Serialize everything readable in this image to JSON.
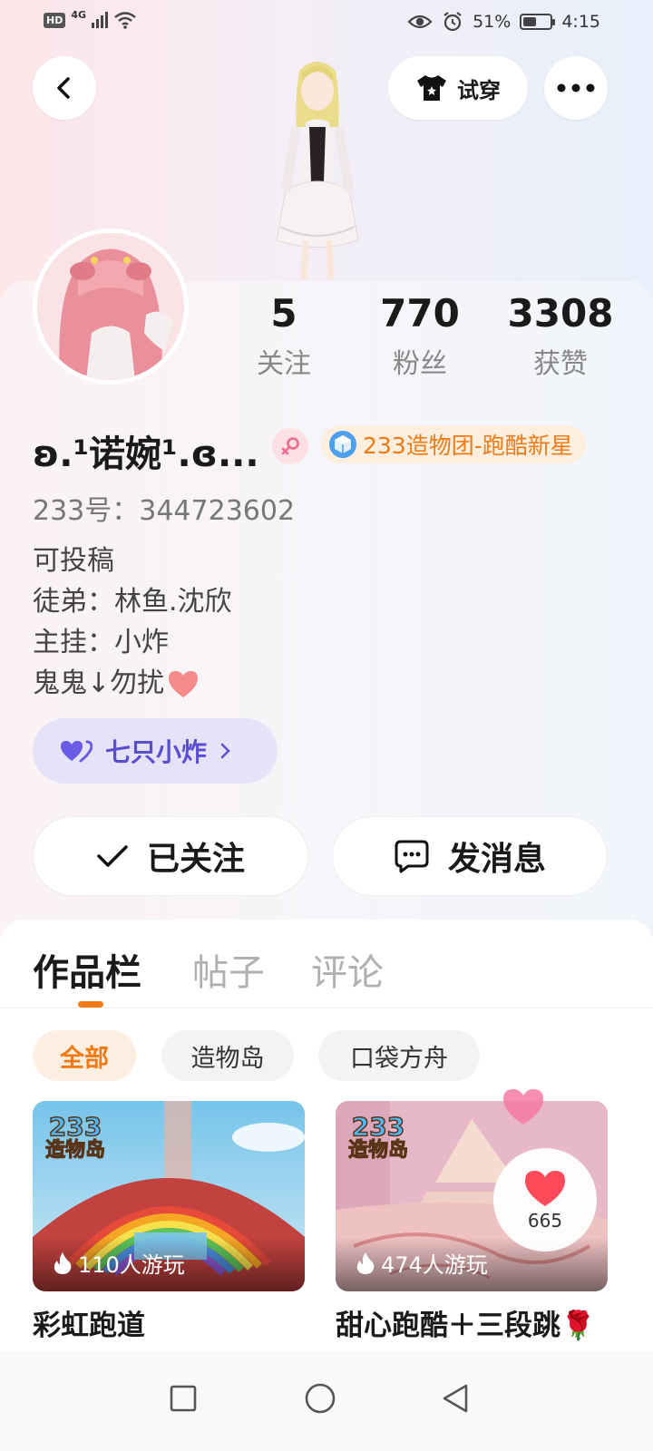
{
  "status_bar": {
    "hd": "HD",
    "network": "4G",
    "battery_percent": "51%",
    "battery_level": 0.51,
    "time": "4:15"
  },
  "header": {
    "try_on_label": "试穿"
  },
  "profile": {
    "stats": [
      {
        "value": "5",
        "label": "关注"
      },
      {
        "value": "770",
        "label": "粉丝"
      },
      {
        "value": "3308",
        "label": "获赞"
      }
    ],
    "nickname": "ʚ.¹诺婉¹.ɞ...",
    "title_badge": "233造物团-跑酷新星",
    "uid": "233号：344723602",
    "bio_lines": [
      "可投稿",
      "徒弟：林鱼.沈欣",
      "主挂：小炸",
      "鬼鬼↓勿扰"
    ],
    "group_name": "七只小炸",
    "follow_button": "已关注",
    "message_button": "发消息"
  },
  "tabs": [
    "作品栏",
    "帖子",
    "评论"
  ],
  "filters": [
    "全部",
    "造物岛",
    "口袋方舟"
  ],
  "works": [
    {
      "logo_top": "233",
      "logo_bottom": "造物岛",
      "plays": "110人游玩",
      "title": "彩虹跑道"
    },
    {
      "logo_top": "233",
      "logo_bottom": "造物岛",
      "plays": "474人游玩",
      "title": "甜心跑酷＋三段跳🌹"
    }
  ],
  "like_count": "665",
  "colors": {
    "accent": "#f07a14",
    "group_purple": "#5b4fd1",
    "like_red": "#ff4a5a"
  },
  "icons": [
    "back-arrow-icon",
    "tshirt-icon",
    "more-dots-icon",
    "female-icon",
    "badge-cube-icon",
    "heart-group-icon",
    "chevron-right-icon",
    "check-icon",
    "chat-bubble-icon",
    "flame-icon",
    "heart-icon",
    "square-nav-icon",
    "circle-nav-icon",
    "triangle-nav-icon"
  ]
}
